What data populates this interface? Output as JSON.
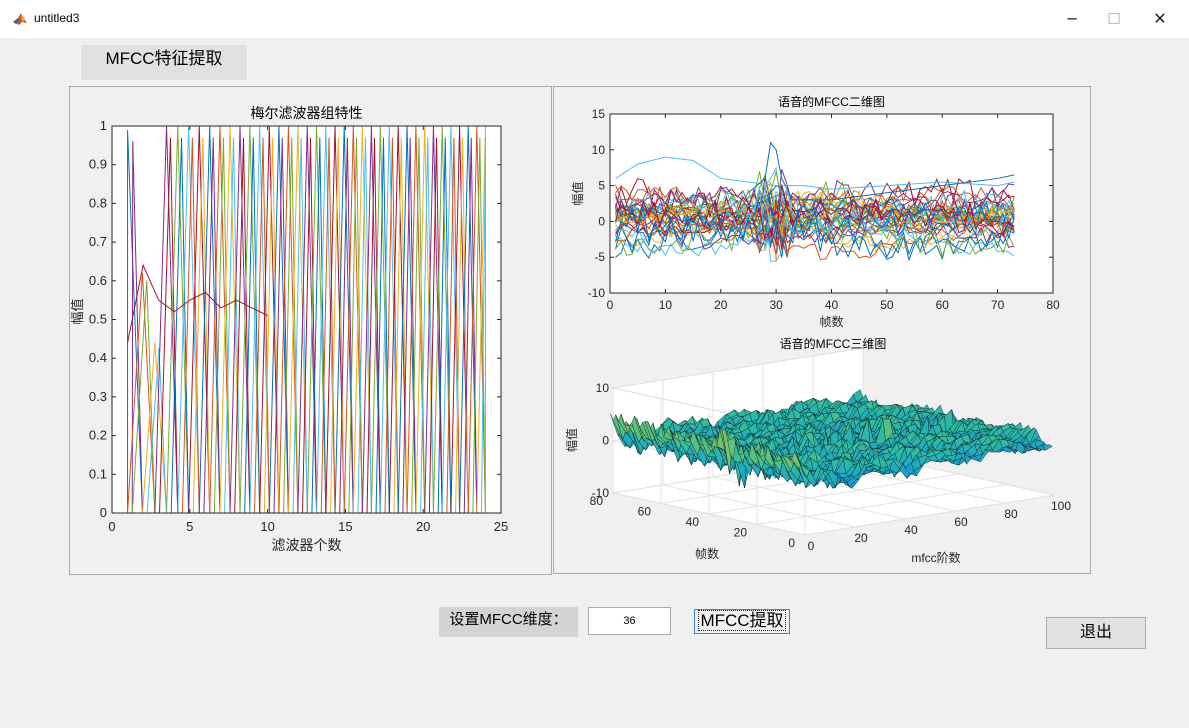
{
  "window": {
    "title": "untitled3",
    "minimize_glyph": "─",
    "maximize_glyph": "☐",
    "close_glyph": "✕",
    "icon": "matlab-logo-icon"
  },
  "panel_title": "MFCC特征提取",
  "controls": {
    "setting_label": "设置MFCC维度：",
    "dimension_value": "36",
    "extract_label": "MFCC提取",
    "exit_label": "退出"
  },
  "chart_data": [
    {
      "type": "line",
      "title": "梅尔滤波器组特性",
      "xlabel": "滤波器个数",
      "ylabel": "幅值",
      "xlim": [
        0,
        25
      ],
      "ylim": [
        0,
        1
      ],
      "xticks": [
        "0",
        "5",
        "10",
        "15",
        "20",
        "25"
      ],
      "yticks": [
        "0",
        "0.1",
        "0.2",
        "0.3",
        "0.4",
        "0.5",
        "0.6",
        "0.7",
        "0.8",
        "0.9",
        "1"
      ],
      "grid": false,
      "description_of_series": "many overlapping triangular filters from x=1 to x=24"
    },
    {
      "type": "line",
      "title": "语音的MFCC二维图",
      "xlabel": "帧数",
      "ylabel": "幅值",
      "xlim": [
        0,
        80
      ],
      "ylim": [
        -10,
        15
      ],
      "xticks": [
        "0",
        "10",
        "20",
        "30",
        "40",
        "50",
        "60",
        "70",
        "80"
      ],
      "yticks": [
        "-10",
        "-5",
        "0",
        "5",
        "10",
        "15"
      ],
      "frames": 73,
      "grid": false
    },
    {
      "type": "surface",
      "title": "语音的MFCC三维图",
      "xlabel": "mfcc阶数",
      "ylabel": "帧数",
      "zlabel": "幅值",
      "xticks": [
        "0",
        "20",
        "40",
        "60",
        "80",
        "100"
      ],
      "yticks": [
        "0",
        "20",
        "40",
        "60",
        "80"
      ],
      "zticks": [
        "-10",
        "0",
        "10"
      ],
      "grid": true
    }
  ],
  "colors": {
    "matlab_order": [
      "#0072bd",
      "#d95319",
      "#edb120",
      "#7e2f8e",
      "#77ac30",
      "#4dbeee",
      "#a2142f"
    ]
  }
}
